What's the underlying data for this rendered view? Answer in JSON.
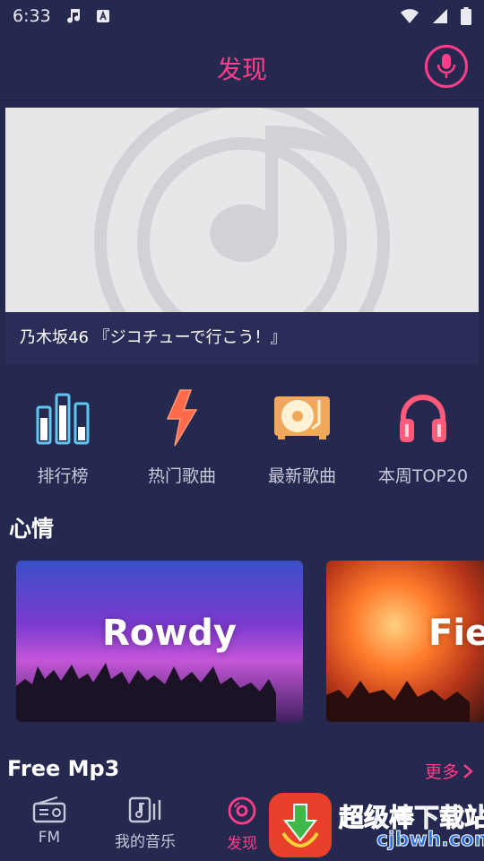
{
  "status_bar": {
    "time": "6:33",
    "icons": [
      "music-notes-icon",
      "a-badge-icon",
      "wifi-icon",
      "signal-icon",
      "battery-icon"
    ]
  },
  "header": {
    "title": "发现",
    "mic_icon": "microphone-icon"
  },
  "banner": {
    "caption": "乃木坂46 『ジコチューで行こう！』"
  },
  "categories": [
    {
      "label": "排行榜",
      "icon": "bar-chart-icon"
    },
    {
      "label": "热门歌曲",
      "icon": "lightning-icon"
    },
    {
      "label": "最新歌曲",
      "icon": "turntable-icon"
    },
    {
      "label": "本周TOP20",
      "icon": "headphones-icon"
    }
  ],
  "mood": {
    "title": "心情",
    "cards": [
      {
        "label": "Rowdy"
      },
      {
        "label": "Fie"
      }
    ]
  },
  "free_mp3": {
    "title": "Free Mp3",
    "more": "更多"
  },
  "bottom_nav": [
    {
      "label": "FM",
      "icon": "radio-icon"
    },
    {
      "label": "我的音乐",
      "icon": "music-library-icon"
    },
    {
      "label": "发现",
      "icon": "disc-icon",
      "active": true
    }
  ],
  "watermark": {
    "text": "超级棒下载站",
    "domain": "cjbwh.com"
  },
  "colors": {
    "background": "#25284f",
    "accent": "#ff3f8a",
    "text_muted": "#c8c9d8"
  }
}
